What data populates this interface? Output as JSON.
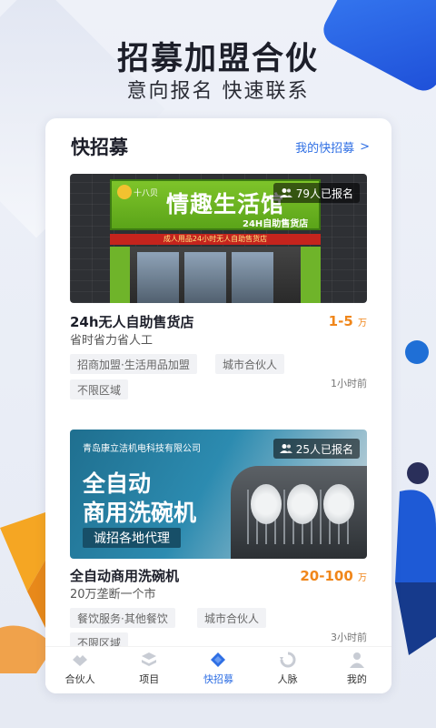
{
  "hero": {
    "title": "招募加盟合伙",
    "subtitle": "意向报名 快速联系"
  },
  "card": {
    "title": "快招募",
    "my_link": "我的快招募",
    "my_link_chevron": ">"
  },
  "jobs": [
    {
      "signup": "79人已报名",
      "name": "24h无人自助售货店",
      "desc": "省时省力省人工",
      "salary": "1-5",
      "salary_unit": "万",
      "tags": [
        "招商加盟·生活用品加盟",
        "城市合伙人",
        "不限区域"
      ],
      "time": "1小时前",
      "image": {
        "brand_small": "十八贝",
        "brand_big": "情趣生活馆",
        "brand_en": "24H自助售货店",
        "band_text": "成人用品24小时无人自助售货店"
      }
    },
    {
      "signup": "25人已报名",
      "name": "全自动商用洗碗机",
      "desc": "20万垄断一个市",
      "salary": "20-100",
      "salary_unit": "万",
      "tags": [
        "餐饮服务·其他餐饮",
        "城市合伙人",
        "不限区域"
      ],
      "time": "3小时前",
      "image": {
        "company": "青岛康立洁机电科技有限公司",
        "line1": "全自动",
        "line2": "商用洗碗机",
        "pill": "诚招各地代理"
      }
    }
  ],
  "tabs": [
    {
      "label": "合伙人",
      "icon": "handshake-icon"
    },
    {
      "label": "项目",
      "icon": "layers-icon"
    },
    {
      "label": "快招募",
      "icon": "diamond-icon"
    },
    {
      "label": "人脉",
      "icon": "refresh-icon"
    },
    {
      "label": "我的",
      "icon": "person-icon"
    }
  ],
  "active_tab": 2,
  "colors": {
    "accent": "#2f6fe4",
    "salary": "#f0861a",
    "tag_bg": "#f1f2f5"
  }
}
